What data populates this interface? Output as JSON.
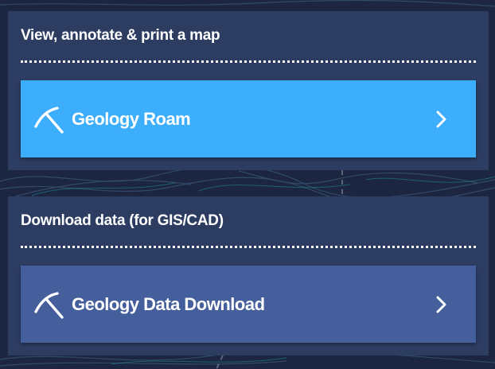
{
  "sections": [
    {
      "title": "View, annotate & print a map",
      "button": {
        "label": "Geology Roam",
        "icon": "pickaxe-icon",
        "arrow_icon": "chevron-right-icon",
        "color": "#3daefc"
      }
    },
    {
      "title": "Download data (for GIS/CAD)",
      "button": {
        "label": "Geology Data Download",
        "icon": "pickaxe-icon",
        "arrow_icon": "chevron-right-icon",
        "color": "#455f9d"
      }
    }
  ],
  "colors": {
    "background": "#1c2640",
    "panel": "#2d3d62",
    "text": "#ffffff"
  }
}
